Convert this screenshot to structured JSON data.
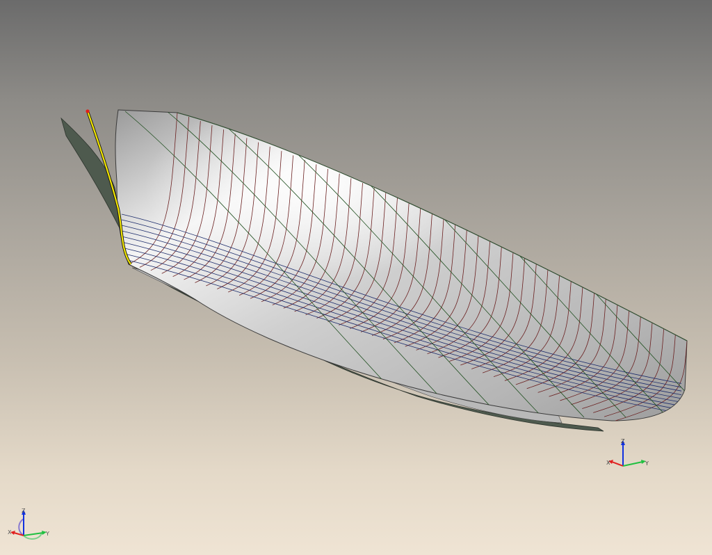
{
  "viewport": {
    "background_top": "#6b6b6b",
    "background_bottom": "#efe4d4"
  },
  "model": {
    "surface_color": "#c9c9c9",
    "section_line_color": "#6a1f1f",
    "waterline_color": "#1a2a6a",
    "buttock_color": "#1f4f1f",
    "selected_curve_color": "#f2e600"
  },
  "triad_small": {
    "x_label": "X",
    "y_label": "Y",
    "z_label": "Z"
  },
  "triad_corner": {
    "x_label": "X",
    "y_label": "Y",
    "z_label": "Z"
  },
  "icons": {
    "triad_small": "xyz-axes-icon",
    "triad_corner": "xyz-axes-icon"
  }
}
